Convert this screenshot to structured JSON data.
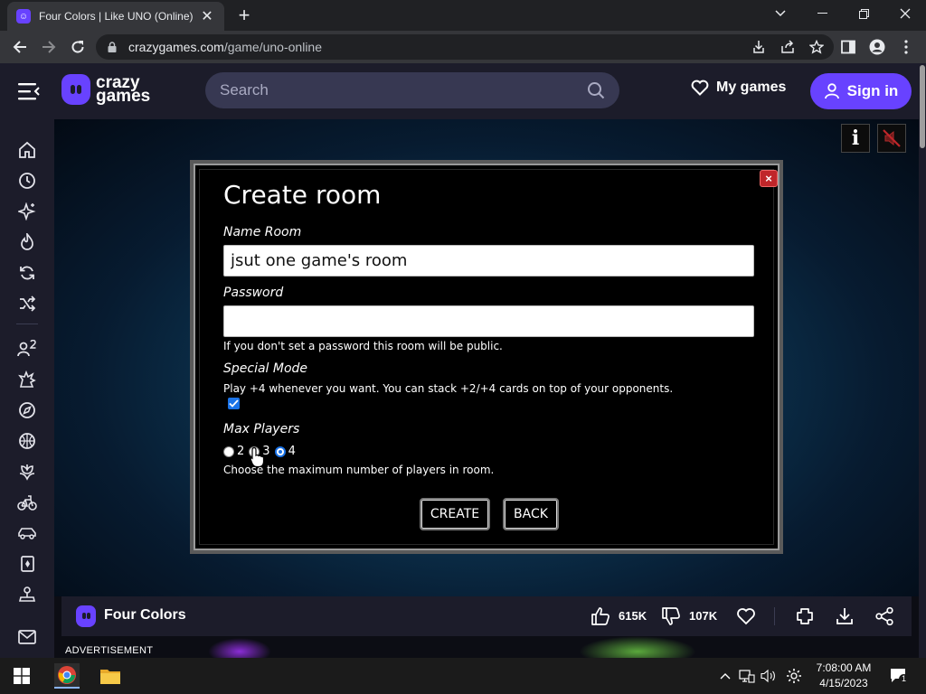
{
  "browser": {
    "tab_title": "Four Colors | Like UNO (Online)",
    "tab_favicon": "crazygames-favicon",
    "url_host": "crazygames.com",
    "url_path": "/game/uno-online"
  },
  "site": {
    "logo_line1": "crazy",
    "logo_line2": "games",
    "search_placeholder": "Search",
    "my_games": "My games",
    "sign_in": "Sign in",
    "accent": "#6842ff"
  },
  "sidebar": {
    "items": [
      {
        "icon": "home-icon"
      },
      {
        "icon": "clock-icon"
      },
      {
        "icon": "sparkle-icon"
      },
      {
        "icon": "flame-icon"
      },
      {
        "icon": "refresh-icon"
      },
      {
        "icon": "shuffle-icon"
      },
      {
        "icon": "multiplayer-icon"
      },
      {
        "icon": "explosion-icon"
      },
      {
        "icon": "compass-icon"
      },
      {
        "icon": "basketball-icon"
      },
      {
        "icon": "flower-icon"
      },
      {
        "icon": "bike-icon"
      },
      {
        "icon": "car-icon"
      },
      {
        "icon": "cards-icon"
      },
      {
        "icon": "joystick-icon"
      },
      {
        "icon": "mail-icon"
      }
    ]
  },
  "game_controls": {
    "info_label": "i"
  },
  "modal": {
    "title": "Create room",
    "name_label": "Name Room",
    "name_value": "jsut one game's room",
    "password_label": "Password",
    "password_value": "",
    "password_help": "If you don't set a password this room will be public.",
    "special_label": "Special Mode",
    "special_help": "Play +4 whenever you want. You can stack +2/+4 cards on top of your opponents.",
    "special_checked": true,
    "max_players_label": "Max Players",
    "player_options": [
      "2",
      "3",
      "4"
    ],
    "player_selected": "4",
    "max_players_help": "Choose the maximum number of players in room.",
    "create_label": "CREATE",
    "back_label": "BACK",
    "close_label": "×"
  },
  "gamebar": {
    "name": "Four Colors",
    "likes": "615K",
    "dislikes": "107K"
  },
  "advertisement_label": "ADVERTISEMENT",
  "taskbar": {
    "time": "7:08:00 AM",
    "date": "4/15/2023",
    "notifications": "1"
  }
}
